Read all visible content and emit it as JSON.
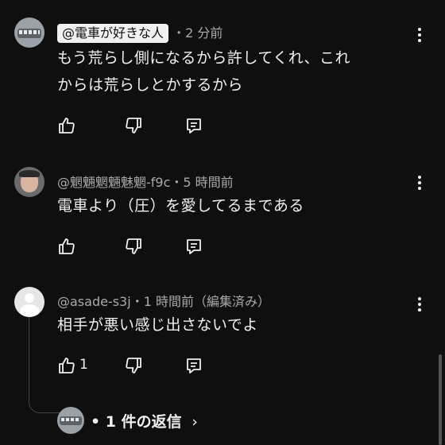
{
  "comments": [
    {
      "author": "@電車が好きな人",
      "time": "・2 分前",
      "text_line1": "もう荒らし側になるから許してくれ、これ",
      "text_line2": "からは荒らしとかするから",
      "likes": ""
    },
    {
      "author": "@魍魎魍魎魅魍-f9c",
      "time": "・5 時間前",
      "text_line1": "電車より（圧）を愛してるまである",
      "likes": ""
    },
    {
      "author": "@asade-s3j",
      "time": "・1 時間前（編集済み）",
      "text_line1": "相手が悪い感じ出さないでよ",
      "likes": "1"
    }
  ],
  "replies": {
    "label": "• 1 件の返信",
    "chevron": "›"
  },
  "icons": [
    "like-icon",
    "dislike-icon",
    "reply-icon",
    "more-vert-icon",
    "chevron-right-icon"
  ]
}
